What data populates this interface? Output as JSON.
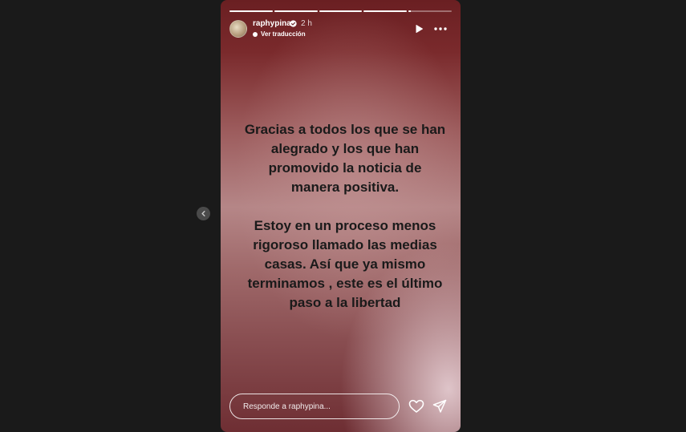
{
  "story": {
    "username": "raphypina",
    "time": "2 h",
    "translate_label": "Ver traducción",
    "progress_segments": [
      1,
      1,
      1,
      1,
      0.05
    ],
    "text": "Gracias a todos los que se han\nalegrado y los que han\npromovido la noticia de\nmanera positiva.\n\nEstoy en un proceso menos\nrigoroso llamado las medias\ncasas. Así que ya mismo\nterminamos , este es el último\npaso a la libertad"
  },
  "reply": {
    "placeholder": "Responde a raphypina..."
  },
  "icons": {
    "prev": "chevron-left-icon",
    "verified": "verified-badge-icon",
    "play": "play-icon",
    "more": "more-horizontal-icon",
    "like": "heart-icon",
    "share": "send-icon"
  },
  "colors": {
    "page_background": "#1a1a1a",
    "story_text": "#1a1a1a",
    "verified_badge": "#ffffff"
  }
}
